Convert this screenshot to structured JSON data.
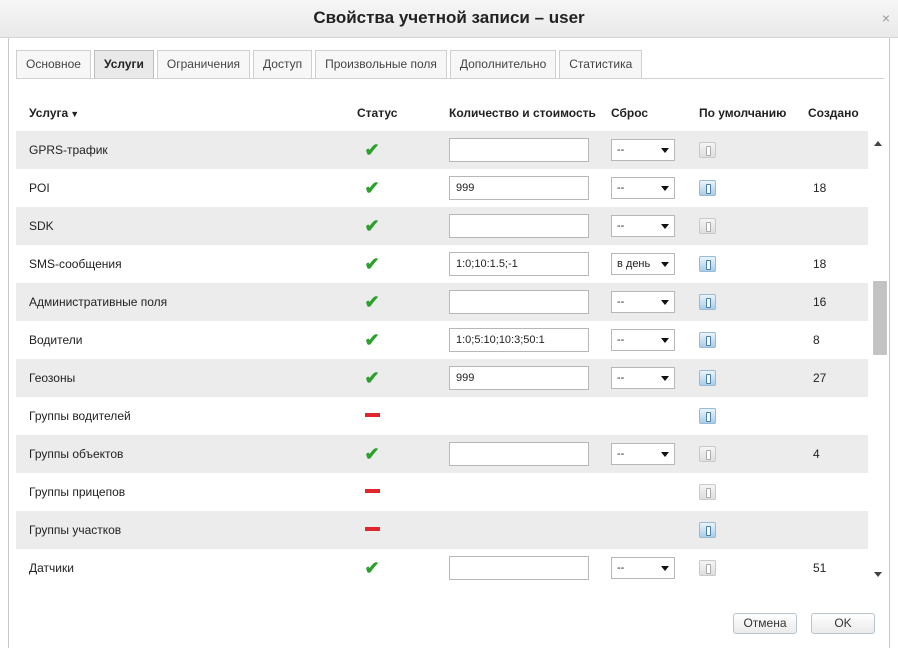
{
  "dialog": {
    "title": "Свойства учетной записи – user",
    "close": "×"
  },
  "tabs": [
    {
      "label": "Основное",
      "active": false
    },
    {
      "label": "Услуги",
      "active": true
    },
    {
      "label": "Ограничения",
      "active": false
    },
    {
      "label": "Доступ",
      "active": false
    },
    {
      "label": "Произвольные поля",
      "active": false
    },
    {
      "label": "Дополнительно",
      "active": false
    },
    {
      "label": "Статистика",
      "active": false
    }
  ],
  "columns": {
    "service": "Услуга",
    "status": "Статус",
    "qty": "Количество и стоимость",
    "reset": "Сброс",
    "default": "По умолчанию",
    "created": "Создано"
  },
  "rows": [
    {
      "name": "GPRS-трафик",
      "status": "on",
      "qty": "",
      "reset": "--",
      "default_active": false,
      "created": ""
    },
    {
      "name": "POI",
      "status": "on",
      "qty": "999",
      "reset": "--",
      "default_active": true,
      "created": "18"
    },
    {
      "name": "SDK",
      "status": "on",
      "qty": "",
      "reset": "--",
      "default_active": false,
      "created": ""
    },
    {
      "name": "SMS-сообщения",
      "status": "on",
      "qty": "1:0;10:1.5;-1",
      "reset": "в день",
      "default_active": true,
      "created": "18"
    },
    {
      "name": "Административные поля",
      "status": "on",
      "qty": "",
      "reset": "--",
      "default_active": true,
      "created": "16"
    },
    {
      "name": "Водители",
      "status": "on",
      "qty": "1:0;5:10;10:3;50:1",
      "reset": "--",
      "default_active": true,
      "created": "8"
    },
    {
      "name": "Геозоны",
      "status": "on",
      "qty": "999",
      "reset": "--",
      "default_active": true,
      "created": "27"
    },
    {
      "name": "Группы водителей",
      "status": "off",
      "qty": null,
      "reset": null,
      "default_active": true,
      "created": ""
    },
    {
      "name": "Группы объектов",
      "status": "on",
      "qty": "",
      "reset": "--",
      "default_active": false,
      "created": "4"
    },
    {
      "name": "Группы прицепов",
      "status": "off",
      "qty": null,
      "reset": null,
      "default_active": false,
      "created": ""
    },
    {
      "name": "Группы участков",
      "status": "off",
      "qty": null,
      "reset": null,
      "default_active": true,
      "created": ""
    },
    {
      "name": "Датчики",
      "status": "on",
      "qty": "",
      "reset": "--",
      "default_active": false,
      "created": "51"
    }
  ],
  "buttons": {
    "cancel": "Отмена",
    "ok": "OK"
  },
  "colors": {
    "check": "#2ca02c",
    "disabled_dash": "#e0262c",
    "row_alt": "#ececec"
  },
  "icons": {
    "status_on": "check-icon",
    "status_off": "dash-icon",
    "default": "default-toggle-icon",
    "sort": "sort-desc-icon"
  }
}
